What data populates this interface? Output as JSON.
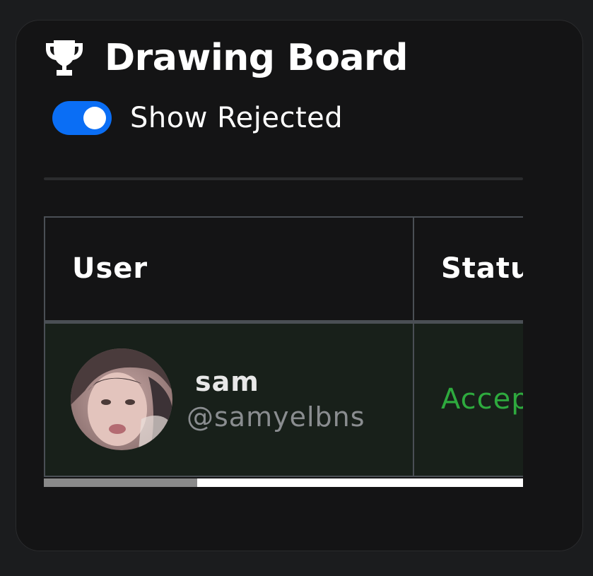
{
  "card": {
    "title": "Drawing Board",
    "title_icon": "trophy-icon"
  },
  "filter": {
    "toggle_label": "Show Rejected",
    "toggle_on": true,
    "toggle_color": "#0a6ef5"
  },
  "table": {
    "columns": [
      "User",
      "Status"
    ],
    "rows": [
      {
        "name": "sam",
        "handle": "@samyelbns",
        "status": "Accepted",
        "status_color": "#2eaa3e"
      }
    ],
    "horizontal_scroll_position": 0
  }
}
